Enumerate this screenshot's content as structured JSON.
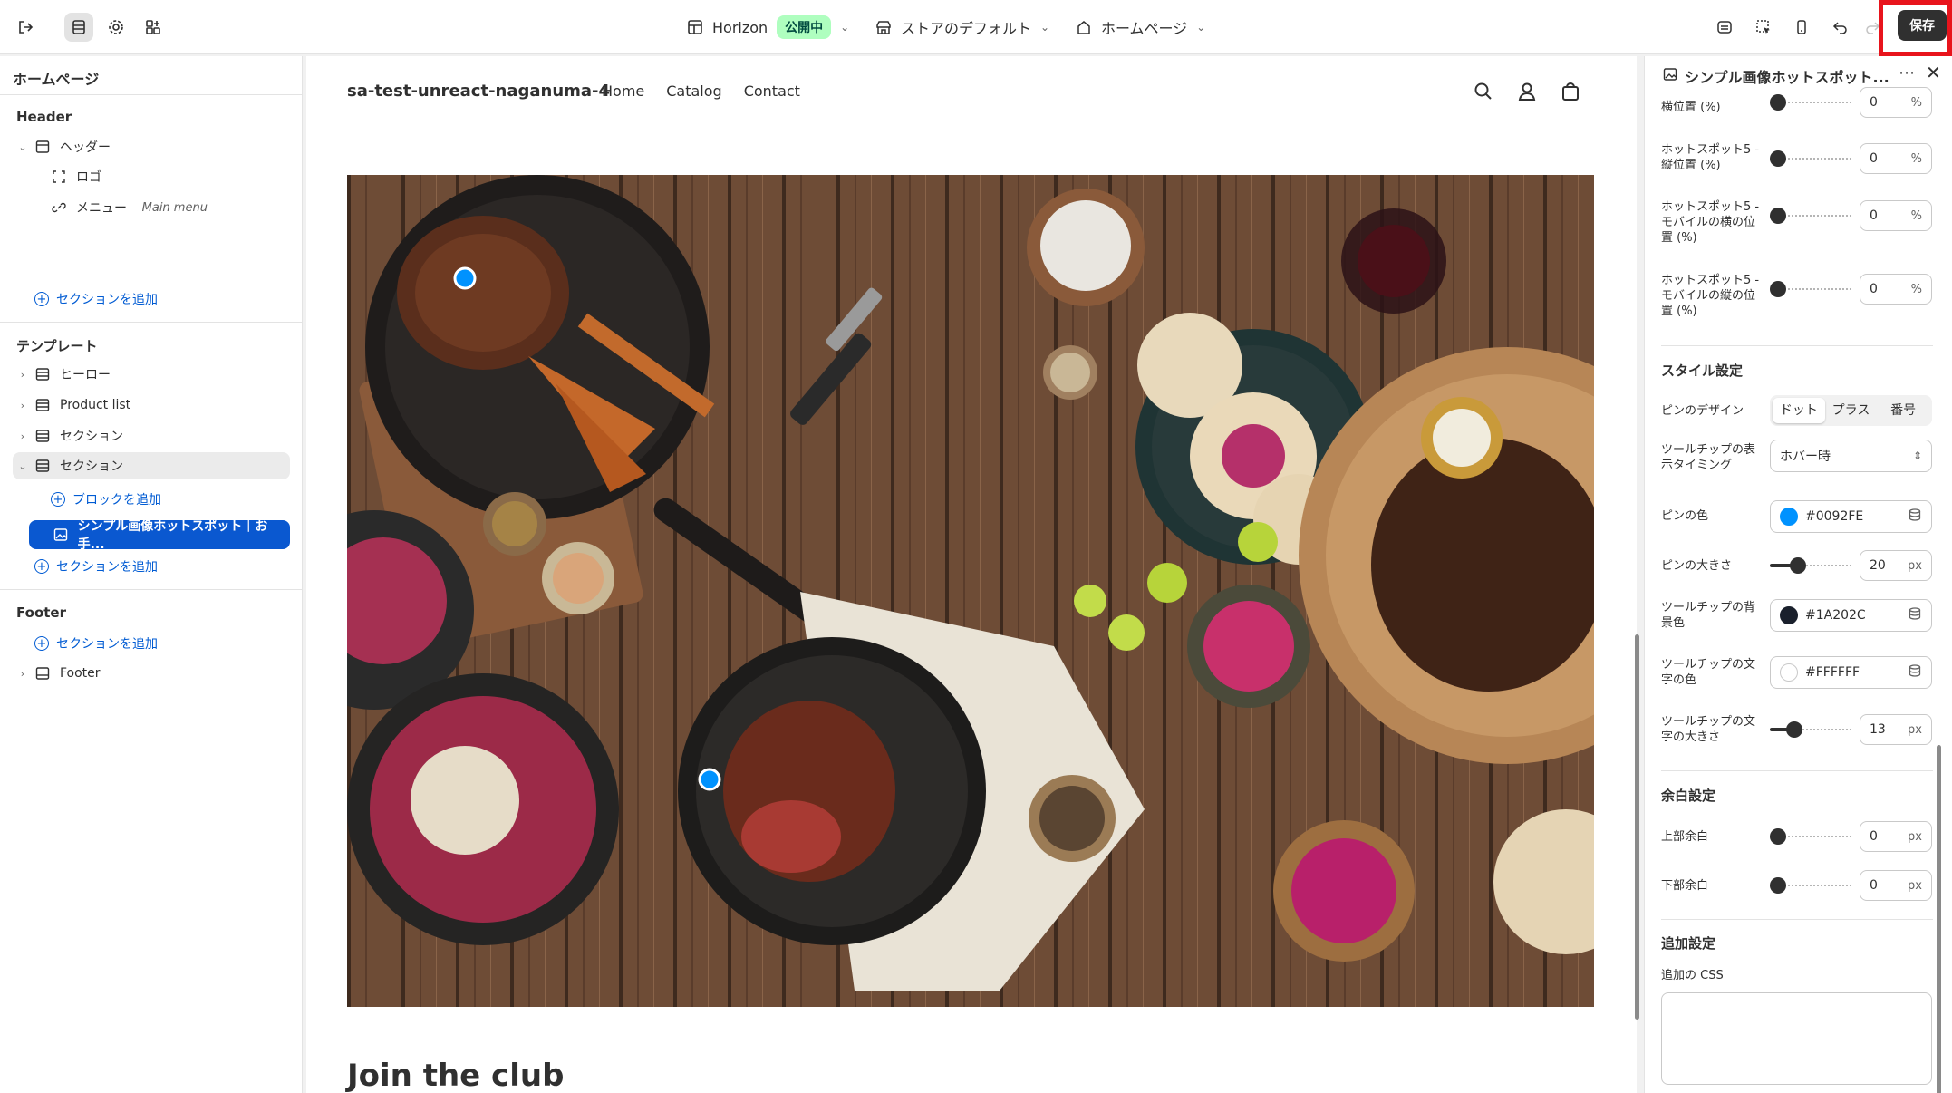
{
  "topbar": {
    "theme_name": "Horizon",
    "theme_status": "公開中",
    "store_default": "ストアのデフォルト",
    "page_select": "ホームページ",
    "save_label": "保存"
  },
  "sidebar": {
    "title": "ホームページ",
    "header_group": "Header",
    "header_section": "ヘッダー",
    "logo_item": "ロゴ",
    "menu_item": "メニュー",
    "menu_item_sub": "– Main menu",
    "add_section": "セクションを追加",
    "template_group": "テンプレート",
    "template_items": [
      "ヒーロー",
      "Product list",
      "セクション",
      "セクション"
    ],
    "add_block": "ブロックを追加",
    "selected_block": "シンプル画像ホットスポット｜お手...",
    "footer_group": "Footer",
    "footer_section": "Footer"
  },
  "preview": {
    "store_name": "sa-test-unreact-naganuma-4",
    "nav": [
      "Home",
      "Catalog",
      "Contact"
    ],
    "join_heading": "Join the club"
  },
  "panel": {
    "title": "シンプル画像ホットスポット...",
    "fields": [
      {
        "label": "横位置 (%)",
        "value": "0",
        "unit": "%",
        "level": 0
      },
      {
        "label": "ホットスポット5 - 縦位置 (%)",
        "value": "0",
        "unit": "%",
        "level": 0
      },
      {
        "label": "ホットスポット5 - モバイルの横の位置 (%)",
        "value": "0",
        "unit": "%",
        "level": 0
      },
      {
        "label": "ホットスポット5 - モバイルの縦の位置 (%)",
        "value": "0",
        "unit": "%",
        "level": 0
      }
    ],
    "style_title": "スタイル設定",
    "pin_design_label": "ピンのデザイン",
    "pin_design_options": [
      "ドット",
      "プラス",
      "番号"
    ],
    "pin_design_selected": "ドット",
    "tooltip_timing_label": "ツールチップの表示タイミング",
    "tooltip_timing_value": "ホバー時",
    "pin_color_label": "ピンの色",
    "pin_color": "#0092FE",
    "pin_size_label": "ピンの大きさ",
    "pin_size_value": "20",
    "pin_size_unit": "px",
    "pin_size_level": 0.35,
    "tooltip_bg_label": "ツールチップの背景色",
    "tooltip_bg": "#1A202C",
    "tooltip_text_color_label": "ツールチップの文字の色",
    "tooltip_text_color": "#FFFFFF",
    "tooltip_text_size_label": "ツールチップの文字の大きさ",
    "tooltip_text_size_value": "13",
    "tooltip_text_size_unit": "px",
    "tooltip_text_size_level": 0.3,
    "margin_title": "余白設定",
    "top_margin_label": "上部余白",
    "top_margin_value": "0",
    "bottom_margin_label": "下部余白",
    "bottom_margin_value": "0",
    "margin_unit": "px",
    "extra_title": "追加設定",
    "extra_css_label": "追加の CSS"
  },
  "colors": {
    "accent": "#005bd3",
    "selected": "#0a58d0",
    "save": "#303030",
    "highlight": "#e8141c"
  }
}
